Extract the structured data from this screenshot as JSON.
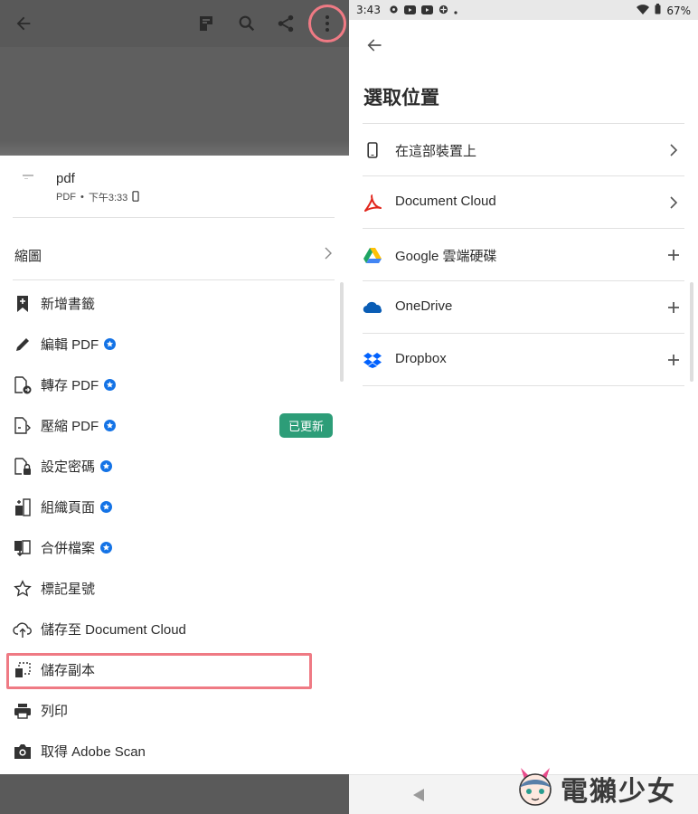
{
  "left": {
    "file": {
      "name": "pdf",
      "type": "PDF",
      "separator": "•",
      "time": "下午3:33"
    },
    "thumbnails_label": "縮圖",
    "menu": [
      {
        "label": "新增書籤",
        "icon": "bookmark-add-icon",
        "premium": false
      },
      {
        "label": "編輯 PDF",
        "icon": "pencil-icon",
        "premium": true
      },
      {
        "label": "轉存 PDF",
        "icon": "export-pdf-icon",
        "premium": true
      },
      {
        "label": "壓縮 PDF",
        "icon": "compress-pdf-icon",
        "premium": true,
        "badge": "已更新"
      },
      {
        "label": "設定密碼",
        "icon": "lock-document-icon",
        "premium": true
      },
      {
        "label": "組織頁面",
        "icon": "organize-pages-icon",
        "premium": true
      },
      {
        "label": "合併檔案",
        "icon": "combine-files-icon",
        "premium": true
      },
      {
        "label": "標記星號",
        "icon": "star-outline-icon",
        "premium": false
      },
      {
        "label": "儲存至 Document Cloud",
        "icon": "cloud-upload-icon",
        "premium": false
      },
      {
        "label": "儲存副本",
        "icon": "save-copy-icon",
        "premium": false
      },
      {
        "label": "列印",
        "icon": "printer-icon",
        "premium": false
      },
      {
        "label": "取得 Adobe Scan",
        "icon": "camera-icon",
        "premium": false
      }
    ]
  },
  "right": {
    "status": {
      "time": "3:43",
      "battery": "67%"
    },
    "title": "選取位置",
    "locations": [
      {
        "label": "在這部裝置上",
        "icon": "phone-icon",
        "action": "chevron-right-icon"
      },
      {
        "label": "Document Cloud",
        "icon": "acrobat-icon",
        "action": "chevron-right-icon"
      },
      {
        "label": "Google 雲端硬碟",
        "icon": "google-drive-icon",
        "action": "plus-icon"
      },
      {
        "label": "OneDrive",
        "icon": "onedrive-icon",
        "action": "plus-icon"
      },
      {
        "label": "Dropbox",
        "icon": "dropbox-icon",
        "action": "plus-icon"
      }
    ]
  },
  "watermark": "電獺少女",
  "colors": {
    "highlight": "#ef7a84",
    "premium_badge": "#1473e6",
    "updated_badge": "#2d9d78",
    "acrobat_red": "#e1251b"
  }
}
